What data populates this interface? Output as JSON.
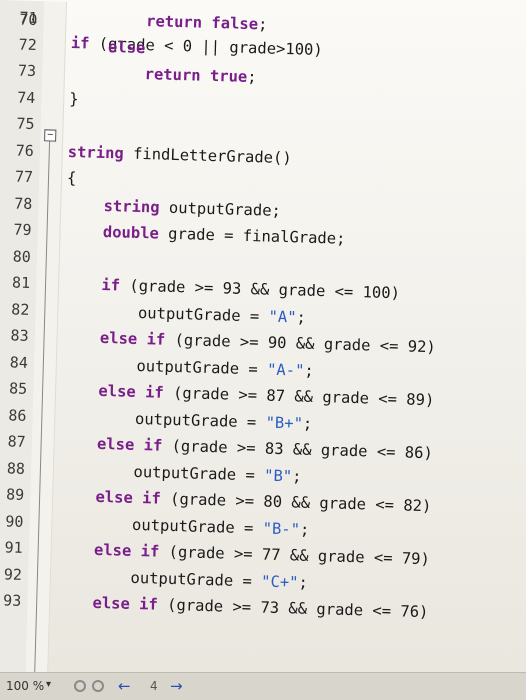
{
  "top_partial": "if (grade < 0 || grade>100)",
  "lines": [
    {
      "n": "71",
      "code": "        return false;"
    },
    {
      "n": "72",
      "code": "    else"
    },
    {
      "n": "73",
      "code": "        return true;"
    },
    {
      "n": "74",
      "code": "}"
    },
    {
      "n": "75",
      "code": ""
    },
    {
      "n": "76",
      "code": "string findLetterGrade()"
    },
    {
      "n": "77",
      "code": "{"
    },
    {
      "n": "78",
      "code": "    string outputGrade;"
    },
    {
      "n": "79",
      "code": "    double grade = finalGrade;"
    },
    {
      "n": "80",
      "code": ""
    },
    {
      "n": "81",
      "code": "    if (grade >= 93 && grade <= 100)"
    },
    {
      "n": "82",
      "code": "        outputGrade = \"A\";"
    },
    {
      "n": "83",
      "code": "    else if (grade >= 90 && grade <= 92)"
    },
    {
      "n": "84",
      "code": "        outputGrade = \"A-\";"
    },
    {
      "n": "85",
      "code": "    else if (grade >= 87 && grade <= 89)"
    },
    {
      "n": "86",
      "code": "        outputGrade = \"B+\";"
    },
    {
      "n": "87",
      "code": "    else if (grade >= 83 && grade <= 86)"
    },
    {
      "n": "88",
      "code": "        outputGrade = \"B\";"
    },
    {
      "n": "89",
      "code": "    else if (grade >= 80 && grade <= 82)"
    },
    {
      "n": "90",
      "code": "        outputGrade = \"B-\";"
    },
    {
      "n": "91",
      "code": "    else if (grade >= 77 && grade <= 79)"
    },
    {
      "n": "92",
      "code": "        outputGrade = \"C+\";"
    },
    {
      "n": "93",
      "code": "    else if (grade >= 73 && grade <= 76)"
    }
  ],
  "status": {
    "zoom": "100 %",
    "zoom_arrow": "▾",
    "warning_count": "4"
  },
  "colors": {
    "keyword": "#7a1f8a",
    "string": "#2a5dc4",
    "text": "#1a1a1a"
  }
}
